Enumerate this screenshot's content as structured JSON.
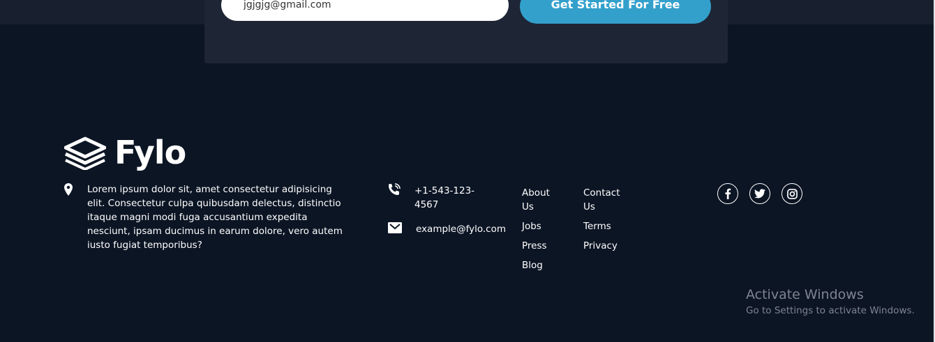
{
  "cta": {
    "email_value": "jgjgjg@gmail.com",
    "button_label": "Get Started For Free"
  },
  "brand": {
    "name": "Fylo",
    "logo_icon": "stacked-layers-icon"
  },
  "footer": {
    "address": "Lorem ipsum dolor sit, amet consectetur adipisicing elit. Consectetur culpa quibusdam delectus, distinctio itaque magni modi fuga accusantium expedita nesciunt, ipsam ducimus in earum dolore, vero autem iusto fugiat temporibus?",
    "phone": "+1-543-123-4567",
    "email": "example@fylo.com",
    "links_col1": [
      "About Us",
      "Jobs",
      "Press",
      "Blog"
    ],
    "links_col2": [
      "Contact Us",
      "Terms",
      "Privacy"
    ],
    "socials": [
      "facebook-icon",
      "twitter-icon",
      "instagram-icon"
    ]
  },
  "watermark": {
    "title": "Activate Windows",
    "subtitle": "Go to Settings to activate Windows."
  },
  "colors": {
    "background": "#0c1524",
    "card": "#1e2535",
    "accent": "#33a0cc"
  }
}
